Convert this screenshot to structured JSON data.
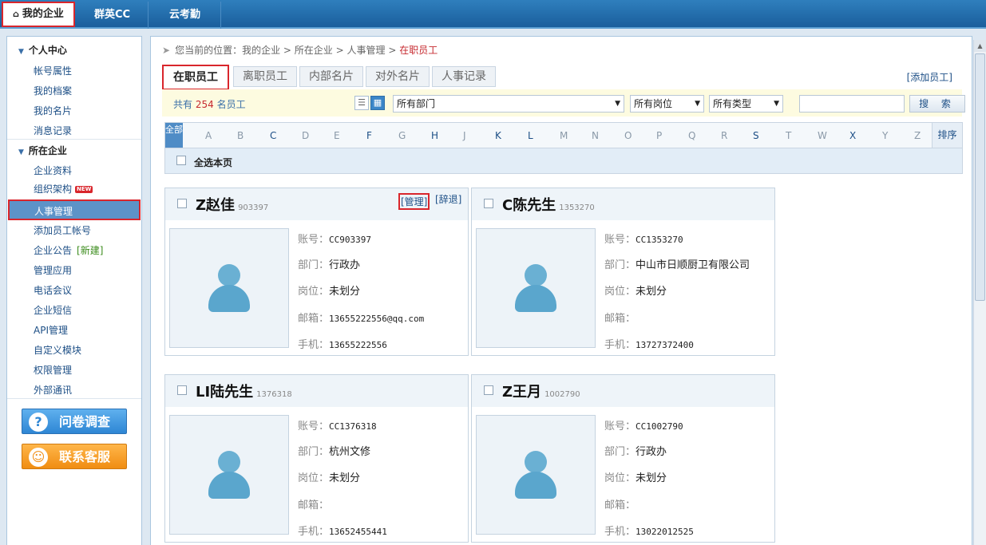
{
  "topnav": [
    "我的企业",
    "群英CC",
    "云考勤"
  ],
  "sidebar": {
    "personal_heading": "个人中心",
    "personal_items": [
      "帐号属性",
      "我的档案",
      "我的名片",
      "消息记录"
    ],
    "company_heading": "所在企业",
    "company_items": [
      "企业资料",
      "组织架构",
      "人事管理",
      "添加员工帐号",
      "企业公告",
      "管理应用",
      "电话会议",
      "企业短信",
      "API管理",
      "自定义模块",
      "权限管理",
      "外部通讯"
    ],
    "new_badge": "NEW",
    "announce_link": "[新建]",
    "survey_button": "问卷调查",
    "service_button": "联系客服"
  },
  "breadcrumb": {
    "prefix": "您当前的位置：",
    "items": [
      "我的企业",
      "所在企业",
      "人事管理"
    ],
    "current": "在职员工"
  },
  "tabs": [
    "在职员工",
    "离职员工",
    "内部名片",
    "对外名片",
    "人事记录"
  ],
  "add_employee": "[添加员工]",
  "filter": {
    "count_prefix": "共有",
    "count": "254",
    "count_suffix": "名员工",
    "department": "所有部门",
    "position": "所有岗位",
    "type": "所有类型",
    "search_value": "",
    "search_button": "搜 索"
  },
  "alphabet": {
    "all": "全部",
    "letters": [
      "A",
      "B",
      "C",
      "D",
      "E",
      "F",
      "G",
      "H",
      "J",
      "K",
      "L",
      "M",
      "N",
      "O",
      "P",
      "Q",
      "R",
      "S",
      "T",
      "W",
      "X",
      "Y",
      "Z"
    ],
    "sort": "排序"
  },
  "select_all": "全选本页",
  "labels": {
    "account": "账号：",
    "department": "部门：",
    "position": "岗位：",
    "email": "邮箱：",
    "phone": "手机：",
    "manage": "[管理]",
    "resign": "[辞退]"
  },
  "employees": [
    {
      "name": "Z赵佳",
      "id": "903397",
      "account": "CC903397",
      "department": "行政办",
      "position": "未划分",
      "email": "13655222556@qq.com",
      "phone": "13655222556"
    },
    {
      "name": "C陈先生",
      "id": "1353270",
      "account": "CC1353270",
      "department": "中山市日顺厨卫有限公司",
      "position": "未划分",
      "email": "",
      "phone": "13727372400"
    },
    {
      "name": "LI陆先生",
      "id": "1376318",
      "account": "CC1376318",
      "department": "杭州文修",
      "position": "未划分",
      "email": "",
      "phone": "13652455441"
    },
    {
      "name": "Z王月",
      "id": "1002790",
      "account": "CC1002790",
      "department": "行政办",
      "position": "未划分",
      "email": "",
      "phone": "13022012525"
    }
  ]
}
